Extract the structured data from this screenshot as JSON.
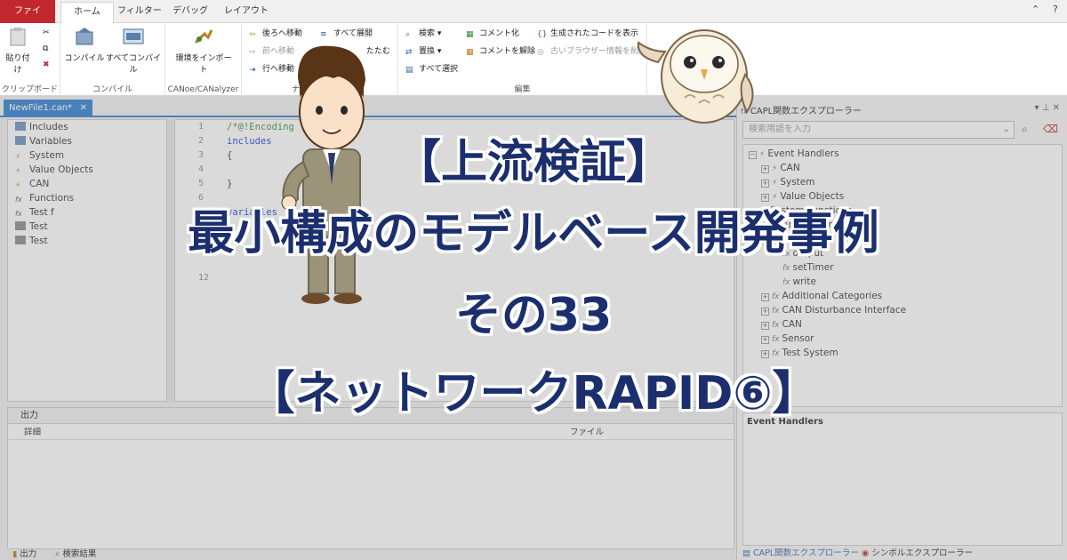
{
  "ribbon": {
    "tabs": [
      "ファイル",
      "ホーム",
      "フィルター",
      "デバッグ",
      "レイアウト"
    ],
    "groups": {
      "clipboard": {
        "label": "クリップボード",
        "paste": "貼り付け"
      },
      "compile": {
        "label": "コンパイル",
        "compile": "コンパイル",
        "compile_all": "すべてコンパイル"
      },
      "canoe": {
        "label": "CANoe/CANalyzer",
        "import_env": "環境をインポート"
      },
      "navigation": {
        "label": "ナビゲーション",
        "back": "後ろへ移動",
        "forward": "前へ移動",
        "goto_line": "行へ移動",
        "expand_all": "すべて展開",
        "collapse_all": "たたむ"
      },
      "edit": {
        "label": "編集",
        "search": "検索",
        "replace": "置換",
        "select_all": "すべて選択",
        "comment": "コメント化",
        "uncomment": "コメントを解除",
        "show_generated": "生成されたコードを表示",
        "old_browser": "古いブラウザー情報を削除"
      }
    }
  },
  "document": {
    "tab_label": "NewFile1.can*",
    "close": "✕"
  },
  "left_tree": [
    "Includes",
    "Variables",
    "System",
    "Value Objects",
    "CAN",
    "Functions",
    "Test f",
    "Test",
    "Test"
  ],
  "editor": {
    "lines": [
      {
        "n": "1",
        "code": "/*@!Encoding"
      },
      {
        "n": "2",
        "code": "includes"
      },
      {
        "n": "3",
        "code": "{"
      },
      {
        "n": "4",
        "code": ""
      },
      {
        "n": "5",
        "code": "}"
      },
      {
        "n": "6",
        "code": ""
      },
      {
        "n": "7",
        "code": "variables"
      },
      {
        "n": "12",
        "code": ""
      }
    ]
  },
  "output": {
    "title": "出力",
    "columns": [
      "詳細",
      "ファイル"
    ],
    "tabs": [
      "出力",
      "検索結果"
    ]
  },
  "right_panel": {
    "title": "CAPL関数エクスプローラー",
    "search_placeholder": "検索用語を入力",
    "tree": [
      {
        "label": "Event Handlers",
        "indent": 0
      },
      {
        "label": "CAN",
        "indent": 1
      },
      {
        "label": "System",
        "indent": 1
      },
      {
        "label": "Value Objects",
        "indent": 1
      },
      {
        "label": "System Functions",
        "indent": 0
      },
      {
        "label": "Application",
        "indent": 1
      },
      {
        "label": "HTTP",
        "indent": 1
      },
      {
        "label": "output",
        "indent": 2
      },
      {
        "label": "setTimer",
        "indent": 2
      },
      {
        "label": "write",
        "indent": 2
      },
      {
        "label": "Additional Categories",
        "indent": 1
      },
      {
        "label": "CAN Disturbance Interface",
        "indent": 1
      },
      {
        "label": "CAN",
        "indent": 1
      },
      {
        "label": "Sensor",
        "indent": 1
      },
      {
        "label": "Test System",
        "indent": 1
      }
    ],
    "event_handlers_label": "Event Handlers",
    "tabs": [
      "CAPL関数エクスプローラー",
      "シンボルエクスプローラー"
    ]
  },
  "headline": {
    "line1": "【上流検証】",
    "line2": "最小構成のモデルベース開発事例",
    "line3": "その33",
    "line4": "【ネットワークRAPID⑥】"
  },
  "colors": {
    "title": "#1b2f6e",
    "accent": "#2b7bd0",
    "file_tab": "#c0282d"
  }
}
